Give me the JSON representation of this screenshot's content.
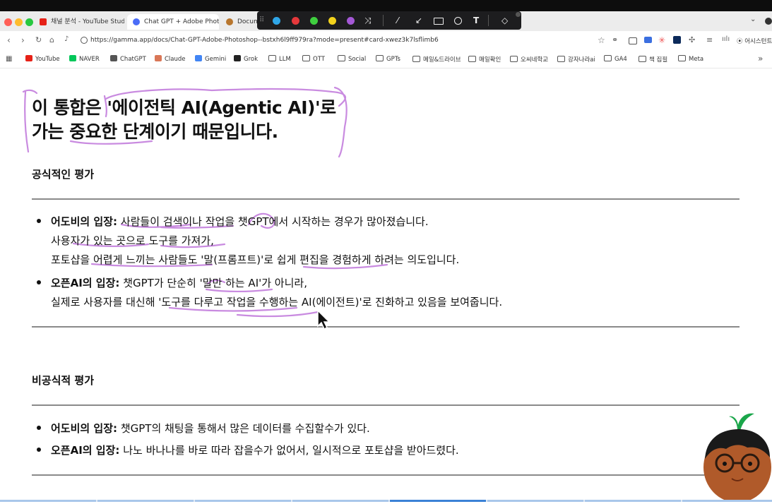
{
  "tabs": [
    {
      "label": "채널 분석 - YouTube Studio",
      "color": "#e62117"
    },
    {
      "label": "Chat GPT + Adobe Photoshop",
      "color": "#4a6cf7"
    },
    {
      "label": "Docume",
      "color": "#b8762e"
    }
  ],
  "url": "https://gamma.app/docs/Chat-GPT-Adobe-Photoshop--bstxh6l9ff979ra?mode=present#card-xwez3k7lsflimb6",
  "profile_label": "어시스턴트",
  "annotation_colors": [
    "#2fa6e8",
    "#e5383b",
    "#3fcf3f",
    "#f2d21c",
    "#a458d6"
  ],
  "bookmarks": [
    {
      "label": "YouTube",
      "icon": "youtube-icon",
      "color": "#e62117"
    },
    {
      "label": "NAVER",
      "icon": "naver-icon",
      "color": "#03c75a"
    },
    {
      "label": "ChatGPT",
      "icon": "chatgpt-icon",
      "color": "#555555"
    },
    {
      "label": "Claude",
      "icon": "claude-icon",
      "color": "#d97757"
    },
    {
      "label": "Gemini",
      "icon": "gemini-icon",
      "color": "#4285f4"
    },
    {
      "label": "Grok",
      "icon": "grok-icon",
      "color": "#222222"
    },
    {
      "label": "LLM",
      "icon": "folder-icon"
    },
    {
      "label": "OTT",
      "icon": "folder-icon"
    },
    {
      "label": "Social",
      "icon": "folder-icon"
    },
    {
      "label": "GPTs",
      "icon": "folder-icon"
    },
    {
      "label": "메일&드라이브",
      "icon": "folder-icon"
    },
    {
      "label": "매일확인",
      "icon": "folder-icon"
    },
    {
      "label": "오씨네학교",
      "icon": "folder-icon"
    },
    {
      "label": "강자나라ai",
      "icon": "folder-icon"
    },
    {
      "label": "GA4",
      "icon": "folder-icon"
    },
    {
      "label": "책 집필",
      "icon": "folder-icon"
    },
    {
      "label": "Meta",
      "icon": "folder-icon"
    }
  ],
  "heading": {
    "line1": "이 통합은 '에이전틱 AI(Agentic AI)'로",
    "line2": "가는 중요한 단계이기 때문입니다."
  },
  "official": {
    "title": "공식적인 평가",
    "items": [
      {
        "label": "어도비의 입장:",
        "lines": [
          "사람들이 검색이나 작업을 챗GPT에서 시작하는 경우가 많아졌습니다.",
          "사용자가 있는 곳으로 도구를 가져가,",
          "포토샵을 어렵게 느끼는 사람들도 '말(프롬프트)'로 쉽게 편집을 경험하게 하려는 의도입니다."
        ]
      },
      {
        "label": "오픈AI의 입장:",
        "lines": [
          "챗GPT가 단순히 '말만 하는 AI'가 아니라,",
          "실제로 사용자를 대신해 '도구를 다루고 작업을 수행하는 AI(에이전트)'로 진화하고 있음을 보여줍니다."
        ]
      }
    ]
  },
  "unofficial": {
    "title": "비공식적 평가",
    "items": [
      {
        "label": "어도비의 입장:",
        "text": "챗GPT의 채팅을 통해서 많은 데이터를 수집할수가 있다."
      },
      {
        "label": "오픈AI의 입장:",
        "text": "나노 바나나를 바로 따라 잡을수가 없어서, 일시적으로 포토샵을 받아드렸다."
      }
    ]
  },
  "highlight_color": "#c98be0"
}
